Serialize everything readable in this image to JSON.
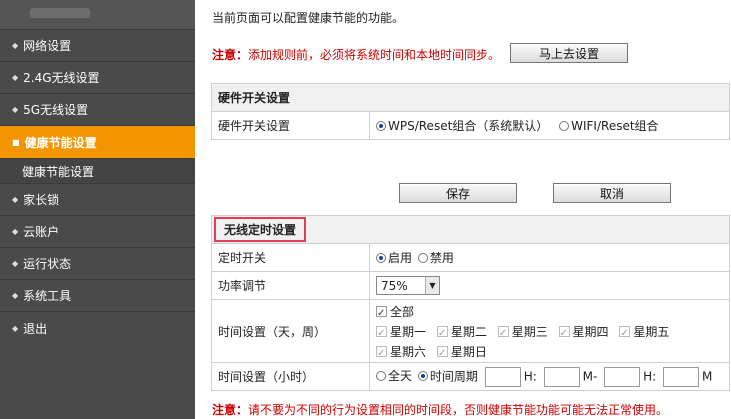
{
  "sidebar": {
    "items": [
      {
        "label": "网络设置"
      },
      {
        "label": "2.4G无线设置"
      },
      {
        "label": "5G无线设置"
      },
      {
        "label": "健康节能设置"
      },
      {
        "label": "家长锁"
      },
      {
        "label": "云账户"
      },
      {
        "label": "运行状态"
      },
      {
        "label": "系统工具"
      },
      {
        "label": "退出"
      }
    ],
    "sub_item": "健康节能设置",
    "active_color": "#f29500",
    "bg_color": "#4a4a4a"
  },
  "intro": "当前页面可以配置健康节能的功能。",
  "note_top": {
    "prefix": "注意：",
    "text": "添加规则前，必须将系统时间和本地时间同步。"
  },
  "buttons": {
    "go_set": "马上去设置",
    "save": "保存",
    "cancel": "取消"
  },
  "hardware": {
    "header": "硬件开关设置",
    "row_label": "硬件开关设置",
    "options": [
      "WPS/Reset组合（系统默认）",
      "WIFI/Reset组合"
    ],
    "selected": "WPS/Reset组合（系统默认）"
  },
  "wireless": {
    "header": "无线定时设置",
    "timer_label": "定时开关",
    "timer_options": [
      "启用",
      "禁用"
    ],
    "timer_selected": "启用",
    "power_label": "功率调节",
    "power_value": "75%",
    "days_label": "时间设置（天，周）",
    "days_all": "全部",
    "days": [
      "星期一",
      "星期二",
      "星期三",
      "星期四",
      "星期五",
      "星期六",
      "星期日"
    ],
    "hours_label": "时间设置（小时）",
    "hours_options": [
      "全天",
      "时间周期"
    ],
    "hours_selected": "时间周期",
    "h_unit": "H",
    "m_unit": "M",
    "colon": ":",
    "dash": "-"
  },
  "note_bottom": {
    "prefix": "注意：",
    "text": "请不要为不同的行为设置相同的时间段，否则健康节能功能可能无法正常使用。"
  },
  "highlight_color": "#e33b5c"
}
